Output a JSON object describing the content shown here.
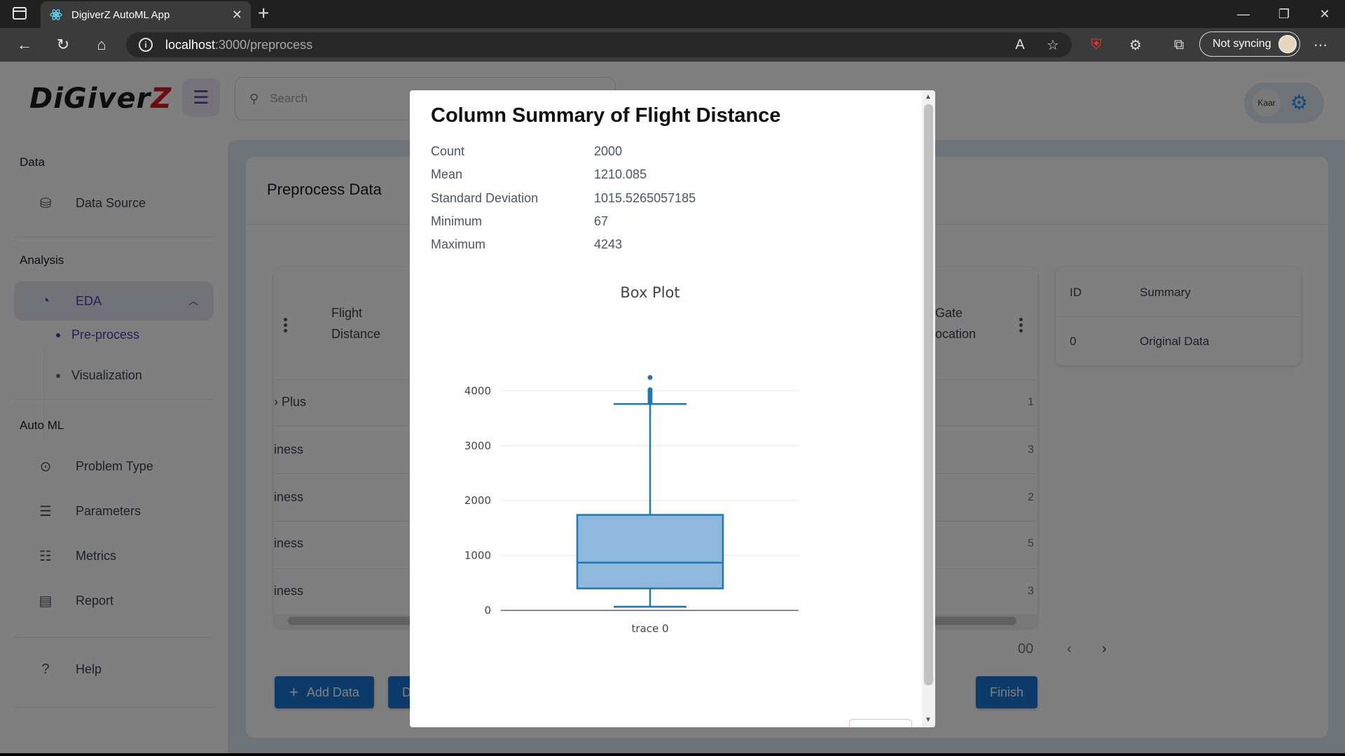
{
  "browser": {
    "tab_title": "DigiverZ AutoML App",
    "url_host": "localhost",
    "url_path": ":3000/preprocess",
    "sync_label": "Not syncing"
  },
  "app": {
    "logo_text_a": "DiGiver",
    "logo_text_b": "Z",
    "search_placeholder": "Search",
    "avatar_label": "Kaar"
  },
  "sidebar": {
    "section_data": "Data",
    "data_source": "Data Source",
    "section_analysis": "Analysis",
    "eda": "EDA",
    "preprocess": "Pre-process",
    "visualization": "Visualization",
    "section_automl": "Auto ML",
    "problem_type": "Problem Type",
    "parameters": "Parameters",
    "metrics": "Metrics",
    "report": "Report",
    "help": "Help"
  },
  "main": {
    "title": "Preprocess Data",
    "col_flight_1": "Flight",
    "col_flight_2": "Distance",
    "col_gate_1": "Gate",
    "col_gate_2": "ocation",
    "rows": [
      {
        "left": "› Plus",
        "right": "1"
      },
      {
        "left": "iness",
        "right": "3"
      },
      {
        "left": "iness",
        "right": "2"
      },
      {
        "left": "iness",
        "right": "5"
      },
      {
        "left": "iness",
        "right": "3"
      }
    ],
    "pager_text": "00",
    "add_data": "Add Data",
    "partial_button": "D",
    "finish": "Finish",
    "summary": {
      "col_id": "ID",
      "col_summary": "Summary",
      "row_id": "0",
      "row_summary": "Original Data"
    }
  },
  "modal": {
    "title": "Column Summary of Flight Distance",
    "stats": [
      {
        "label": "Count",
        "value": "2000"
      },
      {
        "label": "Mean",
        "value": "1210.085"
      },
      {
        "label": "Standard Deviation",
        "value": "1015.5265057185"
      },
      {
        "label": "Minimum",
        "value": "67"
      },
      {
        "label": "Maximum",
        "value": "4243"
      }
    ]
  },
  "chart_data": {
    "type": "box",
    "title": "Box Plot",
    "series": [
      {
        "name": "trace 0",
        "min": 67,
        "q1": 400,
        "median": 870,
        "q3": 1740,
        "upper_fence": 3760,
        "outliers": [
          3800,
          3850,
          3880,
          3920,
          3960,
          4000,
          4020,
          4243
        ]
      }
    ],
    "categories": [
      "trace 0"
    ],
    "yticks": [
      0,
      1000,
      2000,
      3000,
      4000
    ],
    "ylim": [
      0,
      4400
    ],
    "color": "#1f77b4",
    "fill": "#8fb8dc",
    "grid": true
  }
}
